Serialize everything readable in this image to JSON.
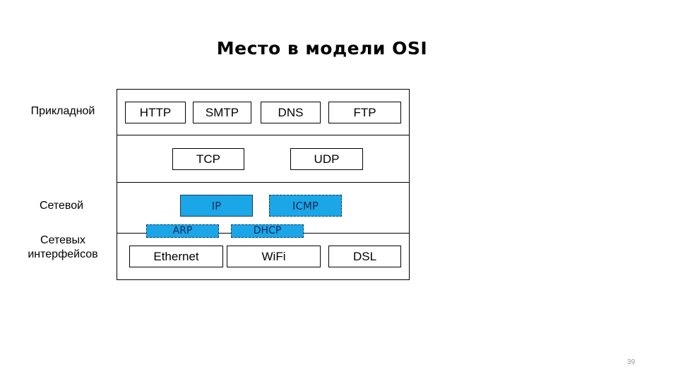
{
  "title": "Место в модели OSI",
  "layers": {
    "application": "Прикладной",
    "network": "Сетевой",
    "link_line1": "Сетевых",
    "link_line2": "интерфейсов"
  },
  "protocols": {
    "application": [
      "HTTP",
      "SMTP",
      "DNS",
      "FTP"
    ],
    "transport": [
      "TCP",
      "UDP"
    ],
    "network": {
      "ip": "IP",
      "icmp": "ICMP",
      "arp": "ARP",
      "dhcp": "DHCP"
    },
    "link": [
      "Ethernet",
      "WiFi",
      "DSL"
    ]
  },
  "colors": {
    "highlight_fill": "#1BA6E8",
    "highlight_text": "#0E2A52"
  },
  "page_number": "39"
}
